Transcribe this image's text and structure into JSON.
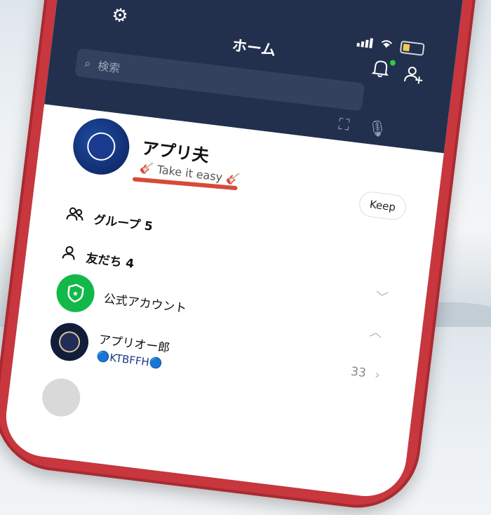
{
  "app": {
    "title": "ホーム",
    "search_placeholder": "検索"
  },
  "profile": {
    "name": "アプリ夫",
    "status_message": "Take it easy",
    "status_decoration_icon": "guitar-emoji",
    "keep_label": "Keep"
  },
  "sections": {
    "groups": {
      "label": "グループ",
      "count": "5"
    },
    "friends": {
      "label": "友だち",
      "count": "4"
    },
    "official": {
      "label": "公式アカウント"
    }
  },
  "friend_list": [
    {
      "name": "アプリオー郎",
      "subtitle": "🔵KTBFFH🔵",
      "count": "33"
    }
  ],
  "colors": {
    "header_bg": "#22304e",
    "accent_green": "#12b84a",
    "phone_body": "#c8363e",
    "highlight_underline": "#d64a39"
  }
}
